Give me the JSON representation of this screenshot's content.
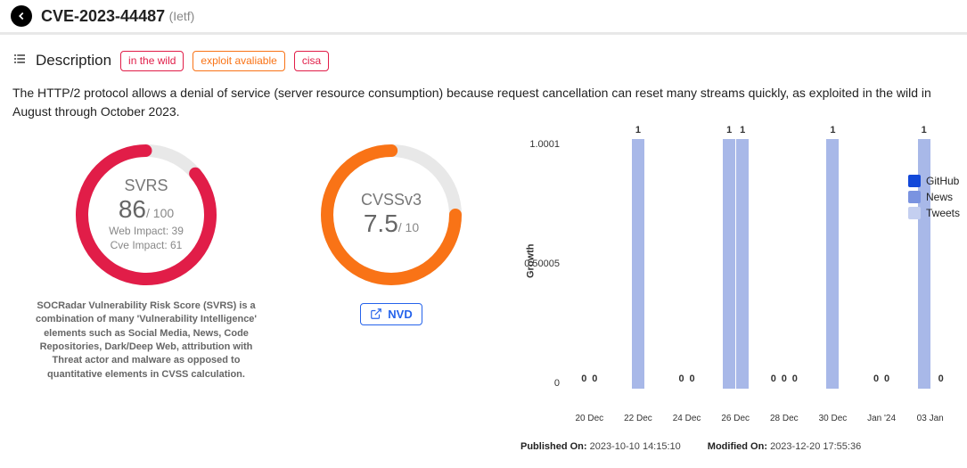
{
  "header": {
    "cve_id": "CVE-2023-44487",
    "suffix": "(Ietf)"
  },
  "section": {
    "title": "Description",
    "tags": [
      "in the wild",
      "exploit avaliable",
      "cisa"
    ]
  },
  "description": "The HTTP/2 protocol allows a denial of service (server resource consumption) because request cancellation can reset many streams quickly, as exploited in the wild in August through October 2023.",
  "svrs": {
    "label": "SVRS",
    "score": "86",
    "max": "/ 100",
    "web_impact": "Web Impact: 39",
    "cve_impact": "Cve Impact: 61",
    "percent": 86,
    "note": "SOCRadar Vulnerability Risk Score (SVRS) is a combination of many 'Vulnerability Intelligence' elements such as Social Media, News, Code Repositories, Dark/Deep Web, attribution with Threat actor and malware as opposed to quantitative elements in CVSS calculation."
  },
  "cvss": {
    "label": "CVSSv3",
    "score": "7.5",
    "max": "/ 10",
    "percent": 75,
    "nvd_label": "NVD"
  },
  "chart_data": {
    "type": "bar",
    "ylabel": "Growth",
    "ylim": [
      0,
      1.0001
    ],
    "yticks": [
      "1.0001",
      "0.50005",
      "0"
    ],
    "categories": [
      "20 Dec",
      "22 Dec",
      "24 Dec",
      "26 Dec",
      "28 Dec",
      "30 Dec",
      "Jan '24",
      "03 Jan"
    ],
    "series": [
      {
        "name": "GitHub",
        "color": "#1248d9"
      },
      {
        "name": "News",
        "color": "#7a93e0"
      },
      {
        "name": "Tweets",
        "color": "#c4cff0"
      }
    ],
    "bars": [
      {
        "x": 0,
        "shift": -6,
        "value": 0,
        "label": "0"
      },
      {
        "x": 0,
        "shift": 6,
        "value": 0,
        "label": "0"
      },
      {
        "x": 1,
        "shift": 0,
        "value": 1,
        "label": "1"
      },
      {
        "x": 2,
        "shift": -6,
        "value": 0,
        "label": "0"
      },
      {
        "x": 2,
        "shift": 6,
        "value": 0,
        "label": "0"
      },
      {
        "x": 3,
        "shift": -7,
        "value": 1,
        "label": "1"
      },
      {
        "x": 3,
        "shift": 8,
        "value": 1,
        "label": "1"
      },
      {
        "x": 4,
        "shift": -12,
        "value": 0,
        "label": "0"
      },
      {
        "x": 4,
        "shift": 0,
        "value": 0,
        "label": "0"
      },
      {
        "x": 4,
        "shift": 12,
        "value": 0,
        "label": "0"
      },
      {
        "x": 5,
        "shift": 0,
        "value": 1,
        "label": "1"
      },
      {
        "x": 6,
        "shift": -6,
        "value": 0,
        "label": "0"
      },
      {
        "x": 6,
        "shift": 6,
        "value": 0,
        "label": "0"
      },
      {
        "x": 7,
        "shift": -7,
        "value": 1,
        "label": "1"
      },
      {
        "x": 7,
        "shift": 12,
        "value": 0,
        "label": "0"
      }
    ]
  },
  "meta": {
    "published_label": "Published On:",
    "published_val": "2023-10-10 14:15:10",
    "modified_label": "Modified On:",
    "modified_val": "2023-12-20 17:55:36"
  }
}
